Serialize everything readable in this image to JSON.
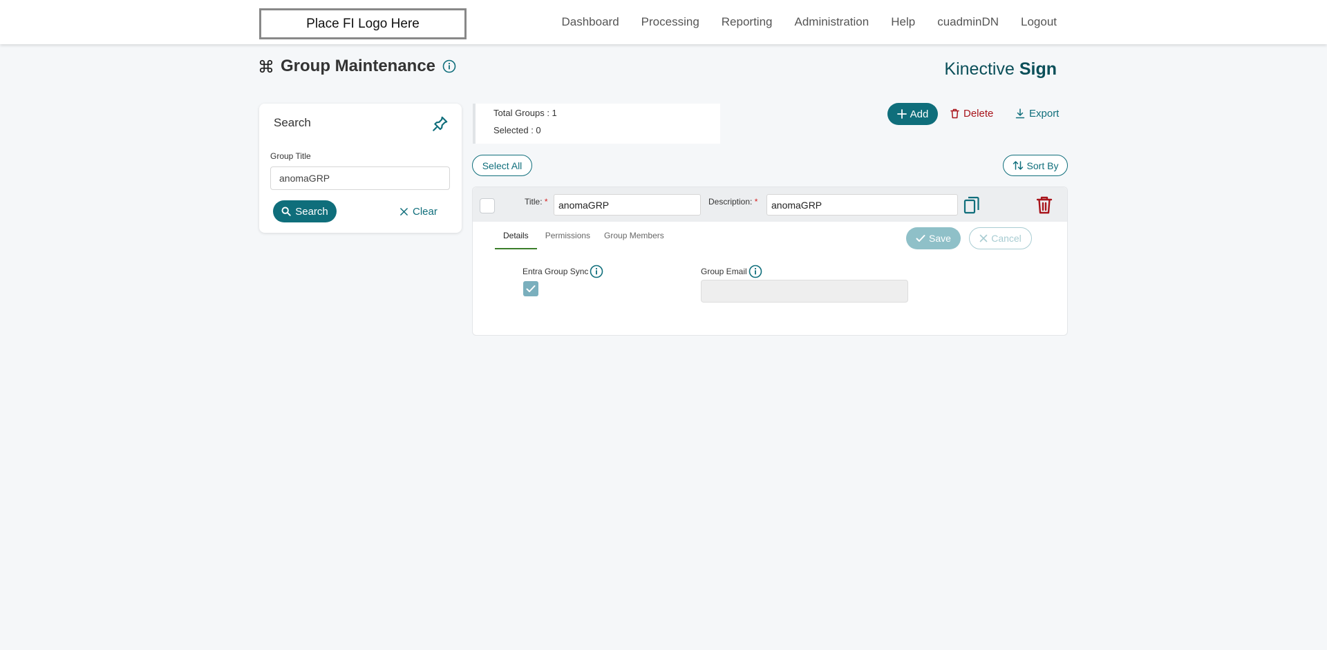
{
  "header": {
    "logo_text": "Place FI Logo Here",
    "nav": [
      "Dashboard",
      "Processing",
      "Reporting",
      "Administration",
      "Help",
      "cuadminDN",
      "Logout"
    ]
  },
  "page": {
    "title": "Group Maintenance",
    "brand_light": "Kinective",
    "brand_bold": "Sign"
  },
  "search_panel": {
    "title": "Search",
    "field_label": "Group Title",
    "field_value": "anomaGRP",
    "search_label": "Search",
    "clear_label": "Clear"
  },
  "summary": {
    "total_groups": "Total Groups : 1",
    "selected": "Selected : 0"
  },
  "toolbar": {
    "add_label": "Add",
    "delete_label": "Delete",
    "export_label": "Export",
    "select_all_label": "Select All",
    "sort_by_label": "Sort By"
  },
  "group": {
    "title_label": "Title:",
    "title_value": "anomaGRP",
    "description_label": "Description:",
    "description_value": "anomaGRP",
    "required_mark": "*",
    "tabs": [
      "Details",
      "Permissions",
      "Group Members"
    ],
    "save_label": "Save",
    "cancel_label": "Cancel",
    "sync_label": "Entra Group Sync",
    "sync_checked": true,
    "email_label": "Group Email",
    "email_value": ""
  },
  "colors": {
    "accent": "#0f6e7b",
    "danger": "#a8141b",
    "brand": "#0b4f59"
  }
}
